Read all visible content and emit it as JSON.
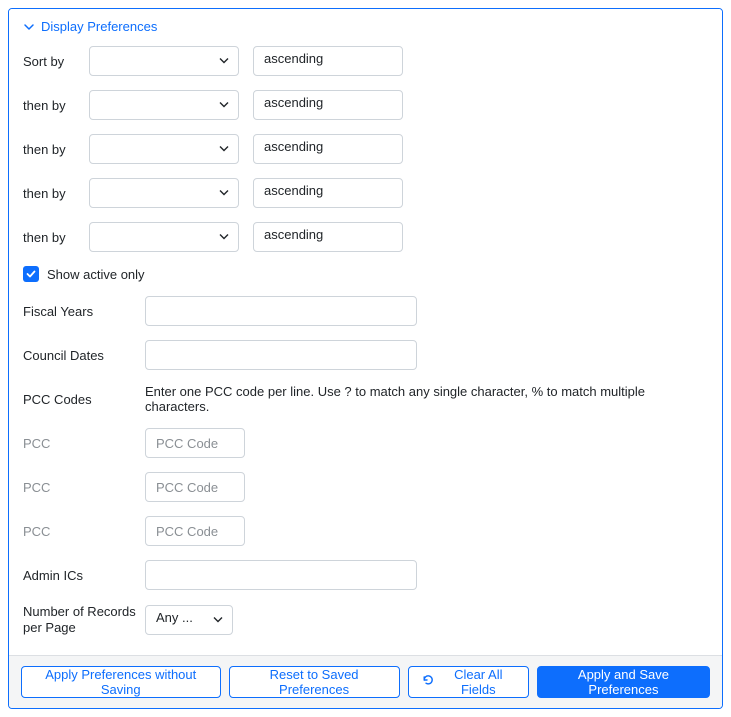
{
  "panel": {
    "title": "Display Preferences"
  },
  "sort": {
    "rows": [
      {
        "label": "Sort by",
        "field": "",
        "direction": "ascending"
      },
      {
        "label": "then by",
        "field": "",
        "direction": "ascending"
      },
      {
        "label": "then by",
        "field": "",
        "direction": "ascending"
      },
      {
        "label": "then by",
        "field": "",
        "direction": "ascending"
      },
      {
        "label": "then by",
        "field": "",
        "direction": "ascending"
      }
    ]
  },
  "active_only": {
    "label": "Show active only",
    "checked": true
  },
  "fiscal_years": {
    "label": "Fiscal Years",
    "value": ""
  },
  "council_dates": {
    "label": "Council Dates",
    "value": ""
  },
  "pcc": {
    "label": "PCC Codes",
    "helper": "Enter one PCC code per line. Use ? to match any single character, % to match multiple characters.",
    "rows": [
      {
        "label": "PCC",
        "placeholder": "PCC Code",
        "value": ""
      },
      {
        "label": "PCC",
        "placeholder": "PCC Code",
        "value": ""
      },
      {
        "label": "PCC",
        "placeholder": "PCC Code",
        "value": ""
      }
    ]
  },
  "admin_ics": {
    "label": "Admin ICs",
    "value": ""
  },
  "records_per_page": {
    "label": "Number of Records per Page",
    "value": "Any ..."
  },
  "buttons": {
    "apply_no_save": "Apply Preferences without Saving",
    "reset": "Reset to Saved Preferences",
    "clear": "Clear All Fields",
    "apply_save": "Apply and Save Preferences"
  }
}
